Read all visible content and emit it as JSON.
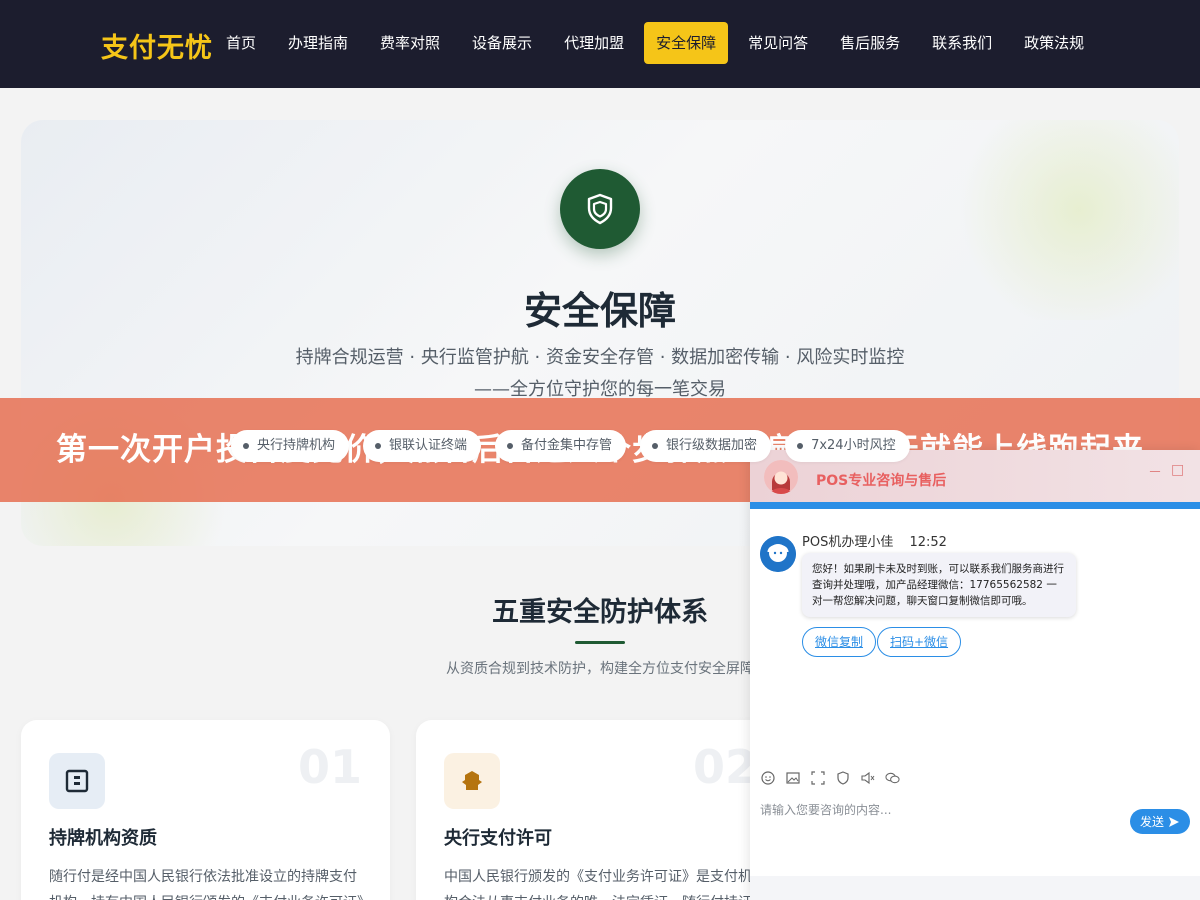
{
  "nav": {
    "logo": "支付无忧",
    "items": [
      {
        "label": "首页",
        "active": false
      },
      {
        "label": "办理指南",
        "active": false
      },
      {
        "label": "费率对照",
        "active": false
      },
      {
        "label": "设备展示",
        "active": false
      },
      {
        "label": "代理加盟",
        "active": false
      },
      {
        "label": "安全保障",
        "active": true
      },
      {
        "label": "常见问答",
        "active": false
      },
      {
        "label": "售后服务",
        "active": false
      },
      {
        "label": "联系我们",
        "active": false
      },
      {
        "label": "政策法规",
        "active": false
      }
    ]
  },
  "hero": {
    "icon": "shield-icon",
    "title": "安全保障",
    "subtitle": "持牌合规运营 · 央行监管护航 · 资金安全存管 · 数据加密传输 · 风险实时监控——全方位守护您的每一笔交易",
    "badges": [
      "央行持牌机构",
      "银联认证终端",
      "备付金集中存管",
      "银行级数据加密",
      "7x24小时风控"
    ]
  },
  "banner": {
    "text": "第一次开户投百度竞价，照着后台这八个步骤点一遍，第一天就能上线跑起来"
  },
  "section": {
    "title": "五重安全防护体系",
    "subtitle": "从资质合规到技术防护，构建全方位支付安全屏障"
  },
  "cards": [
    {
      "num": "01",
      "icon": "license-icon",
      "title": "持牌机构资质",
      "desc": "随行付是经中国人民银行依法批准设立的持牌支付机构，持有中国人民银行颁发的《支付业务许可证》"
    },
    {
      "num": "02",
      "icon": "bank-icon",
      "title": "央行支付许可",
      "desc": "中国人民银行颁发的《支付业务许可证》是支付机构合法从事支付业务的唯一法定凭证，随行付持证"
    }
  ],
  "chat": {
    "title": "POS专业咨询与售后",
    "minimize": "－",
    "maximize": "□",
    "agent_name": "POS机办理小佳",
    "time": "12:52",
    "message": "您好！如果刷卡未及时到账，可以联系我们服务商进行查询并处理哦，加产品经理微信：17765562582 一对一帮您解决问题，聊天窗口复制微信即可哦。",
    "chips": [
      "微信复制",
      "扫码+微信"
    ],
    "tools": [
      "emoji-icon",
      "image-icon",
      "screenshot-icon",
      "rating-icon",
      "audio-icon",
      "wechat-icon"
    ],
    "input_placeholder": "请输入您要咨询的内容...",
    "send_label": "发送"
  },
  "colors": {
    "nav_bg": "#1c1d2e",
    "accent": "#f5c518",
    "primary_green": "#1f5a33",
    "banner": "#e66e50",
    "chat_blue": "#2b8ee6"
  }
}
